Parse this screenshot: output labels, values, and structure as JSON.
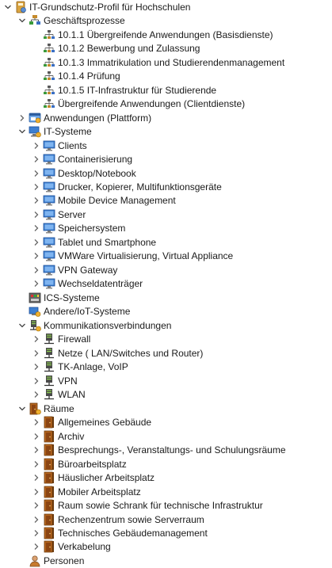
{
  "tree": {
    "nodes": [
      {
        "label": "IT-Grundschutz-Profil für Hochschulen",
        "level": 0,
        "expand": "expanded",
        "icon": "profile-book-icon"
      },
      {
        "label": "Geschäftsprozesse",
        "level": 1,
        "expand": "expanded",
        "icon": "process-group-icon"
      },
      {
        "label": "10.1.1 Übergreifende Anwendungen (Basisdienste)",
        "level": 2,
        "expand": "none",
        "icon": "process-node-icon"
      },
      {
        "label": "10.1.2 Bewerbung und Zulassung",
        "level": 2,
        "expand": "none",
        "icon": "process-node-icon"
      },
      {
        "label": "10.1.3 Immatrikulation und Studierendenmanagement",
        "level": 2,
        "expand": "none",
        "icon": "process-node-icon"
      },
      {
        "label": "10.1.4 Prüfung",
        "level": 2,
        "expand": "none",
        "icon": "process-node-icon"
      },
      {
        "label": "10.1.5 IT-Infrastruktur für Studierende",
        "level": 2,
        "expand": "none",
        "icon": "process-node-icon"
      },
      {
        "label": "Übergreifende Anwendungen (Clientdienste)",
        "level": 2,
        "expand": "none",
        "icon": "process-node-icon"
      },
      {
        "label": "Anwendungen (Plattform)",
        "level": 1,
        "expand": "collapsed",
        "icon": "application-group-icon"
      },
      {
        "label": "IT-Systeme",
        "level": 1,
        "expand": "expanded",
        "icon": "it-systems-group-icon"
      },
      {
        "label": "Clients",
        "level": 2,
        "expand": "collapsed",
        "icon": "monitor-icon"
      },
      {
        "label": "Containerisierung",
        "level": 2,
        "expand": "collapsed",
        "icon": "monitor-icon"
      },
      {
        "label": "Desktop/Notebook",
        "level": 2,
        "expand": "collapsed",
        "icon": "monitor-icon"
      },
      {
        "label": "Drucker, Kopierer, Multifunktionsgeräte",
        "level": 2,
        "expand": "collapsed",
        "icon": "monitor-icon"
      },
      {
        "label": "Mobile Device Management",
        "level": 2,
        "expand": "collapsed",
        "icon": "monitor-icon"
      },
      {
        "label": "Server",
        "level": 2,
        "expand": "collapsed",
        "icon": "monitor-icon"
      },
      {
        "label": "Speichersystem",
        "level": 2,
        "expand": "collapsed",
        "icon": "monitor-icon"
      },
      {
        "label": "Tablet und Smartphone",
        "level": 2,
        "expand": "collapsed",
        "icon": "monitor-icon"
      },
      {
        "label": "VMWare Virtualisierung, Virtual Appliance",
        "level": 2,
        "expand": "collapsed",
        "icon": "monitor-icon"
      },
      {
        "label": "VPN Gateway",
        "level": 2,
        "expand": "collapsed",
        "icon": "monitor-icon"
      },
      {
        "label": "Wechseldatenträger",
        "level": 2,
        "expand": "collapsed",
        "icon": "monitor-icon"
      },
      {
        "label": "ICS-Systeme",
        "level": 1,
        "expand": "none",
        "icon": "ics-systems-icon"
      },
      {
        "label": "Andere/IoT-Systeme",
        "level": 1,
        "expand": "none",
        "icon": "iot-systems-icon"
      },
      {
        "label": "Kommunikationsverbindungen",
        "level": 1,
        "expand": "expanded",
        "icon": "network-group-icon"
      },
      {
        "label": "Firewall",
        "level": 2,
        "expand": "collapsed",
        "icon": "network-node-icon"
      },
      {
        "label": "Netze ( LAN/Switches und Router)",
        "level": 2,
        "expand": "collapsed",
        "icon": "network-node-icon"
      },
      {
        "label": "TK-Anlage, VoIP",
        "level": 2,
        "expand": "collapsed",
        "icon": "network-node-icon"
      },
      {
        "label": "VPN",
        "level": 2,
        "expand": "collapsed",
        "icon": "network-node-icon"
      },
      {
        "label": "WLAN",
        "level": 2,
        "expand": "collapsed",
        "icon": "network-node-icon"
      },
      {
        "label": "Räume",
        "level": 1,
        "expand": "expanded",
        "icon": "room-group-icon"
      },
      {
        "label": "Allgemeines Gebäude",
        "level": 2,
        "expand": "collapsed",
        "icon": "room-icon"
      },
      {
        "label": "Archiv",
        "level": 2,
        "expand": "collapsed",
        "icon": "room-icon"
      },
      {
        "label": "Besprechungs-, Veranstaltungs- und Schulungsräume",
        "level": 2,
        "expand": "collapsed",
        "icon": "room-icon"
      },
      {
        "label": "Büroarbeitsplatz",
        "level": 2,
        "expand": "collapsed",
        "icon": "room-icon"
      },
      {
        "label": "Häuslicher Arbeitsplatz",
        "level": 2,
        "expand": "collapsed",
        "icon": "room-icon"
      },
      {
        "label": "Mobiler Arbeitsplatz",
        "level": 2,
        "expand": "collapsed",
        "icon": "room-icon"
      },
      {
        "label": "Raum sowie Schrank für technische Infrastruktur",
        "level": 2,
        "expand": "collapsed",
        "icon": "room-icon"
      },
      {
        "label": "Rechenzentrum sowie Serverraum",
        "level": 2,
        "expand": "collapsed",
        "icon": "room-icon"
      },
      {
        "label": "Technisches Gebäudemanagement",
        "level": 2,
        "expand": "collapsed",
        "icon": "room-icon"
      },
      {
        "label": "Verkabelung",
        "level": 2,
        "expand": "collapsed",
        "icon": "room-icon"
      },
      {
        "label": "Personen",
        "level": 1,
        "expand": "none",
        "icon": "person-icon"
      }
    ]
  }
}
